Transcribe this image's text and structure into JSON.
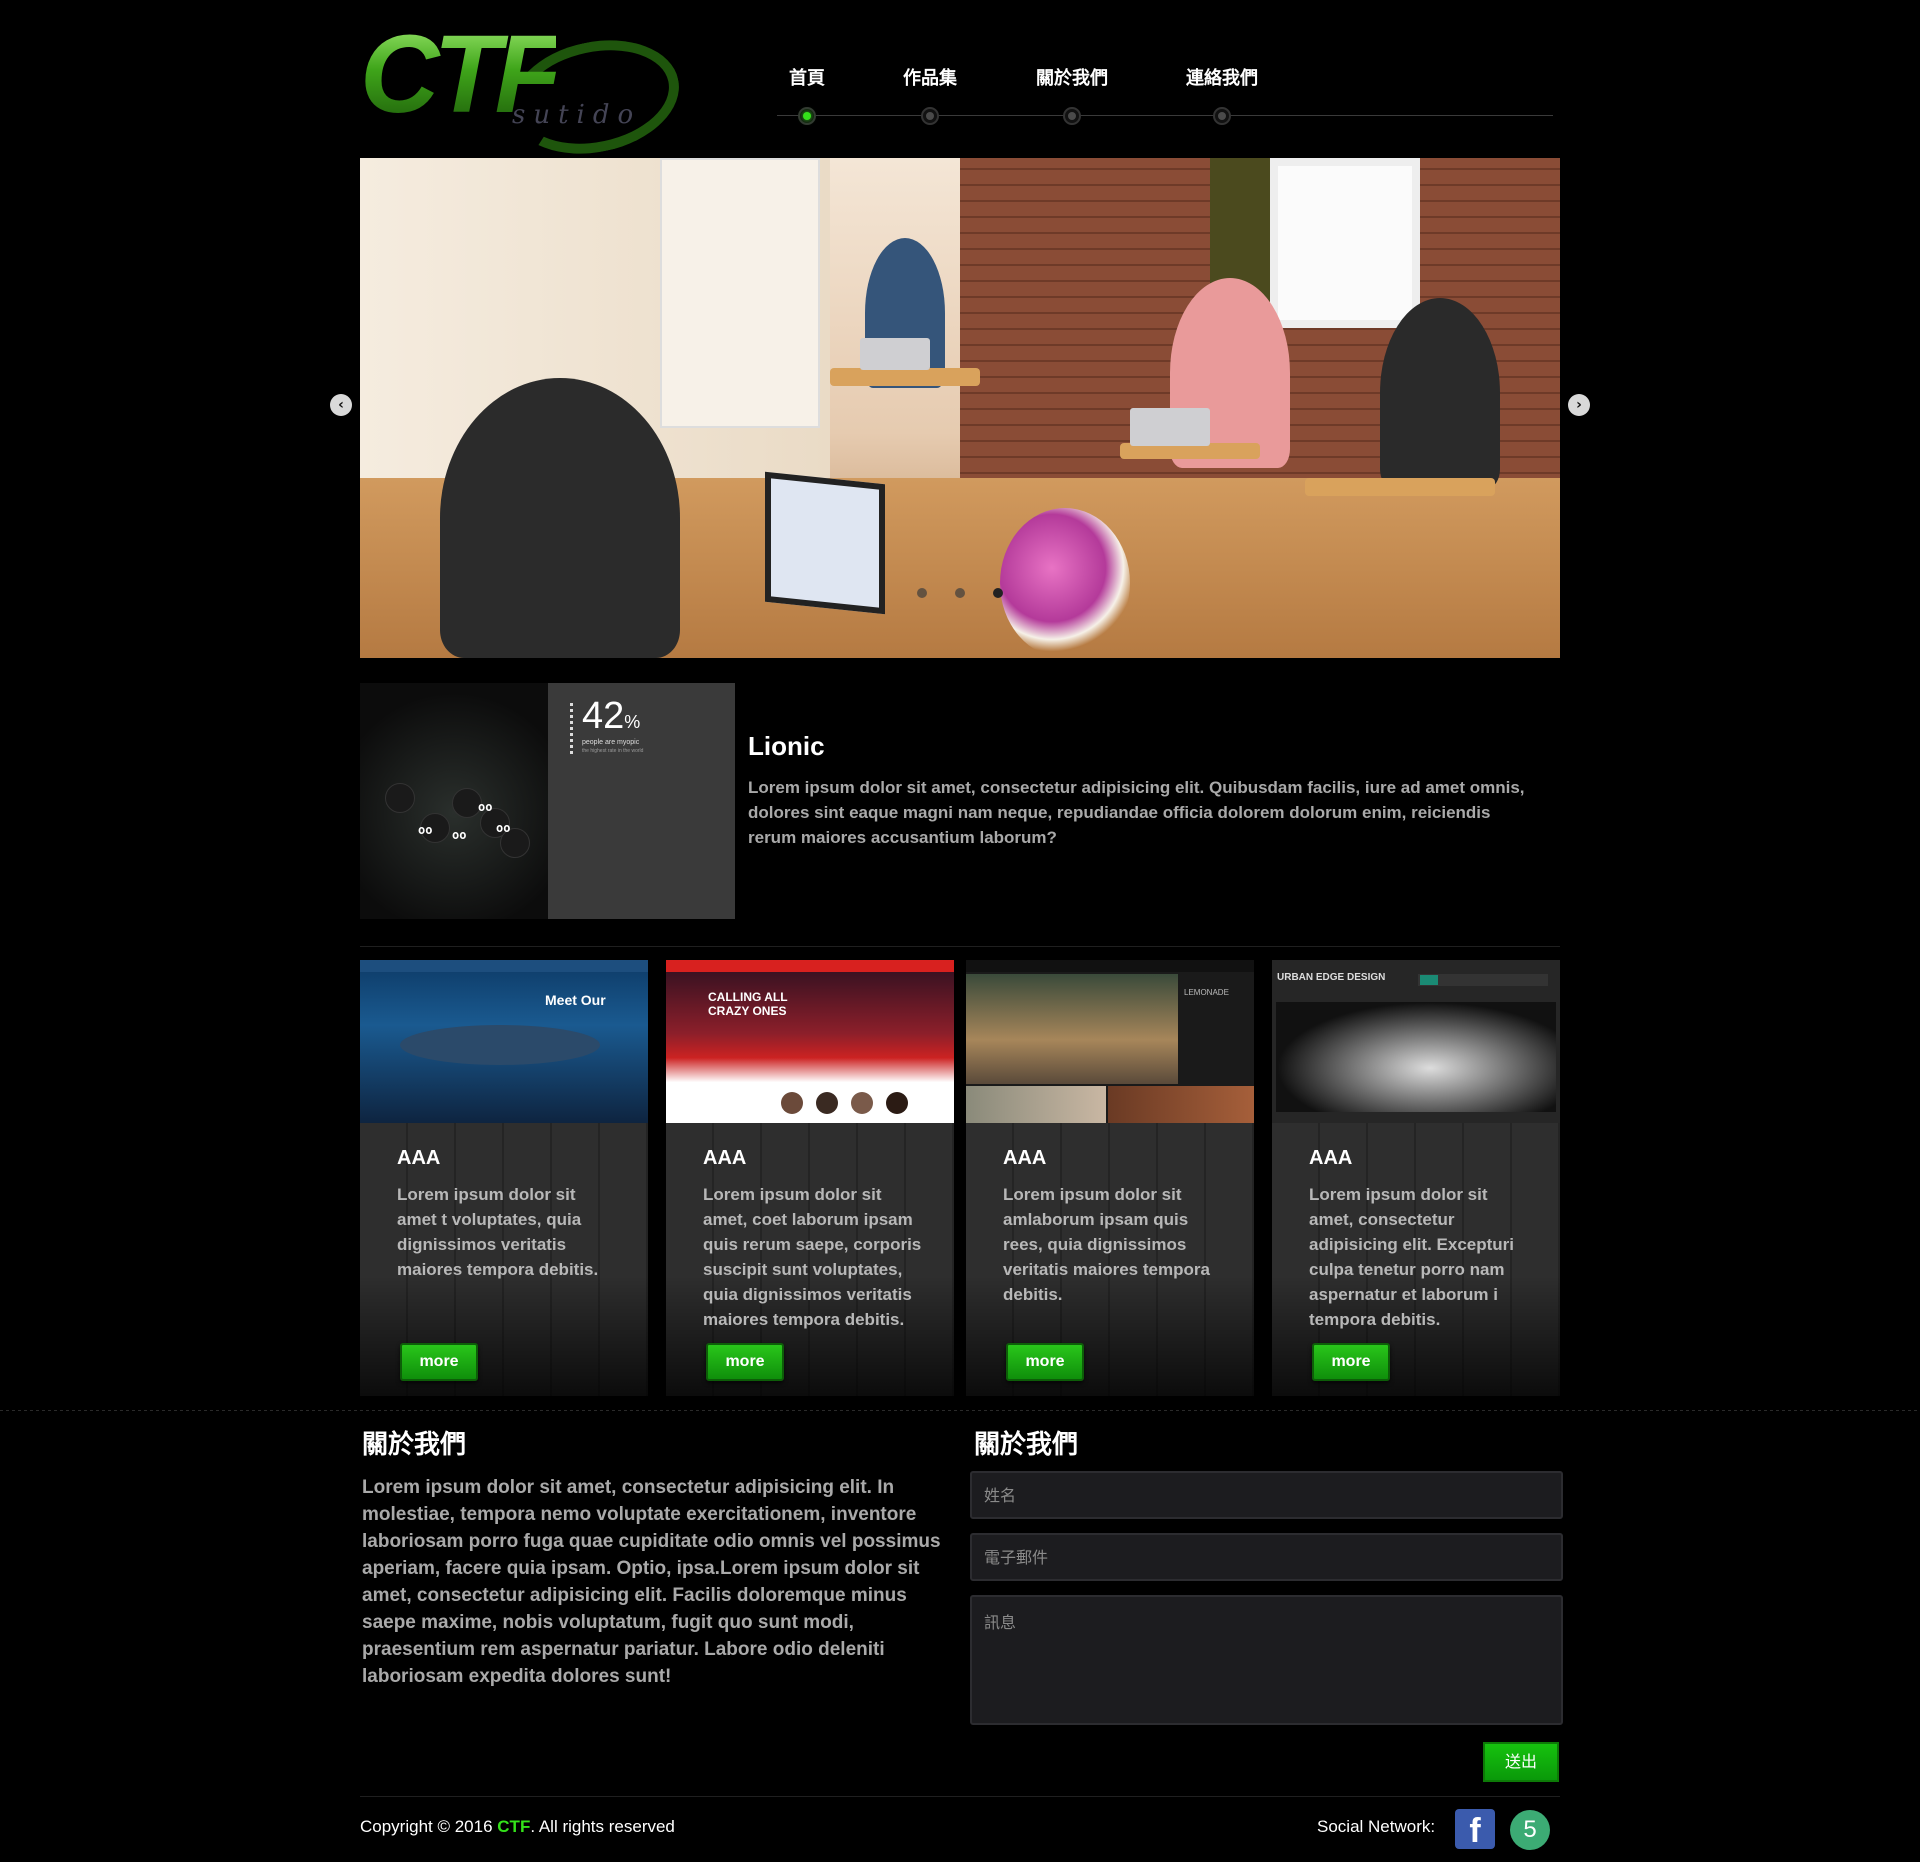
{
  "brand": {
    "logo_text": "CTF",
    "logo_sub": "sutido"
  },
  "nav": {
    "items": [
      {
        "label": "首頁",
        "active": true
      },
      {
        "label": "作品集",
        "active": false
      },
      {
        "label": "關於我們",
        "active": false
      },
      {
        "label": "連絡我們",
        "active": false
      }
    ]
  },
  "slider": {
    "prev_icon": "chevron-left-icon",
    "next_icon": "chevron-right-icon",
    "dots": 3,
    "active_dot": 3
  },
  "feature": {
    "stat_value": "42",
    "stat_unit": "%",
    "stat_caption": "people are myopic",
    "stat_subcaption": "the highest rate in the world",
    "title": "Lionic",
    "text": "Lorem ipsum dolor sit amet, consectetur adipisicing elit. Quibusdam facilis, iure ad amet omnis, dolores sint eaque magni nam neque, repudiandae officia dolorem dolorum enim, reiciendis rerum maiores accusantium laborum?"
  },
  "cards": [
    {
      "title": "AAA",
      "text": "Lorem ipsum dolor sit amet t voluptates, quia dignissimos veritatis maiores tempora debitis.",
      "button": "more",
      "thumb_heading": "Meet Our"
    },
    {
      "title": "AAA",
      "text": "Lorem ipsum dolor sit amet, coet laborum ipsam quis rerum saepe, corporis suscipit sunt voluptates, quia dignissimos veritatis maiores tempora debitis.",
      "button": "more",
      "thumb_heading": "CALLING ALL CRAZY ONES"
    },
    {
      "title": "AAA",
      "text": "Lorem ipsum dolor sit amlaborum ipsam quis rees, quia dignissimos veritatis maiores tempora debitis.",
      "button": "more",
      "thumb_heading": "LEMONADE"
    },
    {
      "title": "AAA",
      "text": "Lorem ipsum dolor sit amet, consectetur adipisicing elit. Excepturi culpa tenetur porro nam aspernatur et laborum i tempora debitis.",
      "button": "more",
      "thumb_heading": "URBAN EDGE DESIGN"
    }
  ],
  "about": {
    "heading": "關於我們",
    "text": "Lorem ipsum dolor sit amet, consectetur adipisicing elit. In molestiae, tempora nemo voluptate exercitationem, inventore laboriosam porro fuga quae cupiditate odio omnis vel possimus aperiam, facere quia ipsam. Optio, ipsa.Lorem ipsum dolor sit amet, consectetur adipisicing elit. Facilis doloremque minus saepe maxime, nobis voluptatum, fugit quo sunt modi, praesentium rem aspernatur pariatur. Labore odio deleniti laboriosam expedita dolores sunt!"
  },
  "contact_form": {
    "heading": "關於我們",
    "name_placeholder": "姓名",
    "email_placeholder": "電子郵件",
    "message_placeholder": "訊息",
    "submit_label": "送出"
  },
  "footer": {
    "copyright_prefix": "Copyright © 2016 ",
    "copyright_brand": "CTF",
    "copyright_suffix": ". All rights reserved",
    "social_label": "Social Network:",
    "social_icons": [
      "facebook-icon",
      "html5-icon"
    ],
    "facebook_glyph": "f",
    "html5_glyph": "5"
  },
  "colors": {
    "accent": "#34e21a",
    "button": "#14b10e",
    "background": "#000000"
  }
}
